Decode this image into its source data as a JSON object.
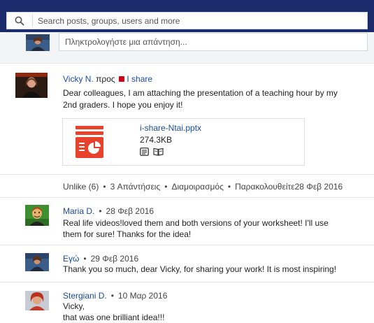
{
  "search": {
    "placeholder": "Search posts, groups, users and more"
  },
  "reply": {
    "placeholder": "Πληκτρολογήστε μια απάντηση..."
  },
  "post": {
    "author": "Vicky N.",
    "to_word": "προς",
    "group": "I share",
    "group_color": "#d0021b",
    "text_line1": "Dear colleagues, I am attaching the presentation of a teaching hour by my",
    "text_line2": "2nd graders. I hope you enjoy it!",
    "attachment": {
      "filename": "i-share-Ntai.pptx",
      "size": "274.3KB",
      "icon": "pptx-file-icon",
      "icon_color": "#e8412c",
      "actions": [
        "view-icon",
        "read-icon"
      ]
    },
    "actions": {
      "unlike": "Unlike (6)",
      "replies": "3 Απάντήσεις",
      "share": "Διαμοιρασμός",
      "follow": "Παρακολουθείτε",
      "date": "28 Φεβ 2016"
    }
  },
  "comments": [
    {
      "author": "Maria D.",
      "date": "28 Φεβ 2016",
      "line1": "Real life videos!loved them and both versions of your worksheet! I'll use",
      "line2": "them for sure! Thanks for the idea!"
    },
    {
      "author": "Εγώ",
      "date": "29 Φεβ 2016",
      "line1": "Thank you so much, dear Vicky, for sharing your work! It is most inspiring!"
    },
    {
      "author": "Stergiani D.",
      "date": "10 Μαρ 2016",
      "line1": "Vicky,",
      "line2": "that was one brilliant idea!!!"
    }
  ],
  "separator": "•"
}
